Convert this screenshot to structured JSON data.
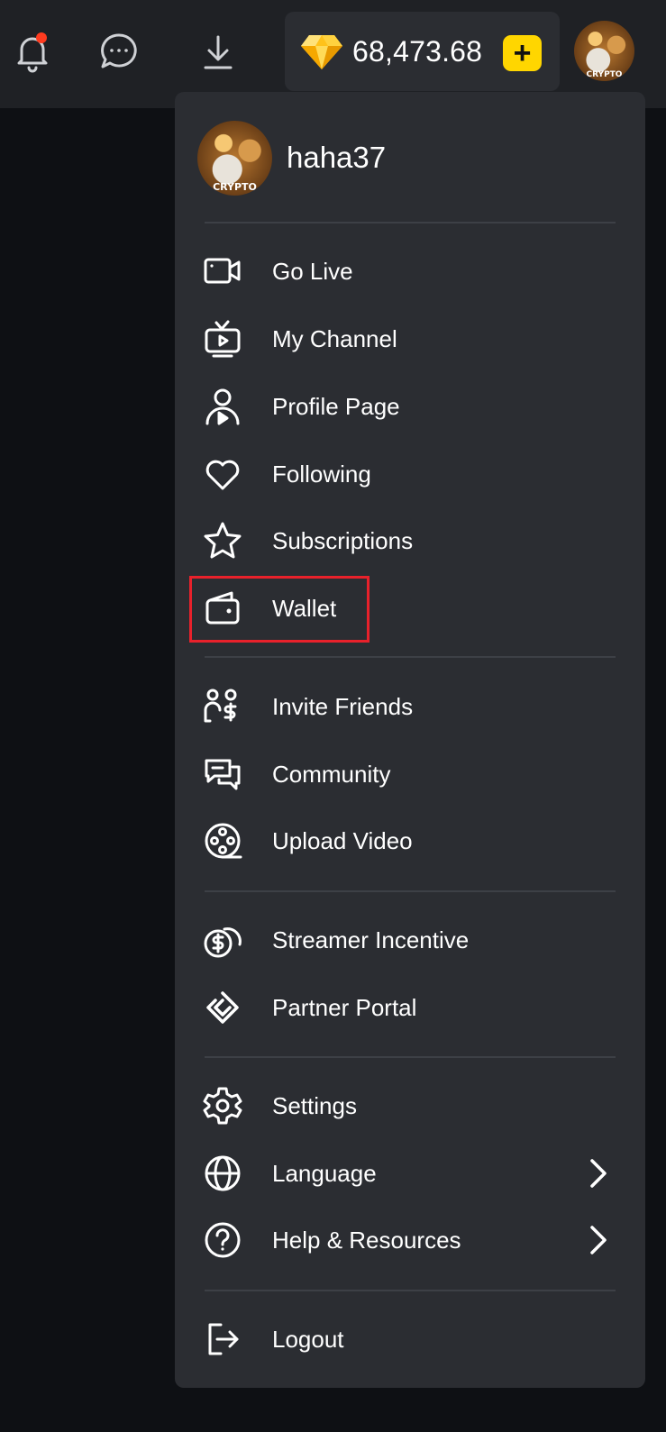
{
  "topbar": {
    "balance": "68,473.68",
    "add_symbol": "+"
  },
  "user": {
    "username": "haha37",
    "avatar_text": "CRYPTO"
  },
  "menu": {
    "items": [
      {
        "label": "Go Live",
        "icon": "video-camera-icon"
      },
      {
        "label": "My Channel",
        "icon": "tv-channel-icon"
      },
      {
        "label": "Profile Page",
        "icon": "profile-play-icon"
      },
      {
        "label": "Following",
        "icon": "heart-icon"
      },
      {
        "label": "Subscriptions",
        "icon": "star-icon"
      },
      {
        "label": "Wallet",
        "icon": "wallet-icon"
      },
      {
        "label": "Invite Friends",
        "icon": "invite-friends-icon"
      },
      {
        "label": "Community",
        "icon": "community-chat-icon"
      },
      {
        "label": "Upload Video",
        "icon": "film-reel-icon"
      },
      {
        "label": "Streamer Incentive",
        "icon": "coins-dollar-icon"
      },
      {
        "label": "Partner Portal",
        "icon": "handshake-diamond-icon"
      },
      {
        "label": "Settings",
        "icon": "gear-icon"
      },
      {
        "label": "Language",
        "icon": "globe-icon"
      },
      {
        "label": "Help & Resources",
        "icon": "question-circle-icon"
      },
      {
        "label": "Logout",
        "icon": "logout-icon"
      }
    ]
  },
  "colors": {
    "topbar_bg": "#1f2125",
    "menu_bg": "#2b2d32",
    "page_bg": "#0e1014",
    "accent_yellow": "#ffd600",
    "notification_dot": "#ff3b1f",
    "highlight_red": "#e8212b"
  }
}
